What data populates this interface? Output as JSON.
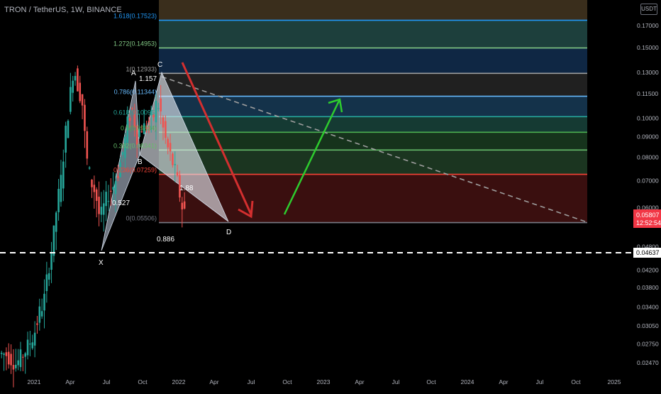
{
  "header": {
    "title": "TRON / TetherUS, 1W, BINANCE",
    "currency_badge": "USDT"
  },
  "chart_data": {
    "type": "candlestick",
    "symbol": "TRON / TetherUS",
    "interval": "1W",
    "exchange": "BINANCE",
    "y_axis": {
      "scale": "log",
      "ticks": [
        "0.17000",
        "0.15000",
        "0.13000",
        "0.11500",
        "0.10000",
        "0.09000",
        "0.08000",
        "0.07000",
        "0.06000",
        "0.04800",
        "0.04200",
        "0.03800",
        "0.03400",
        "0.03050",
        "0.02750",
        "0.02470"
      ],
      "ylim": [
        0.0235,
        0.19
      ]
    },
    "x_axis": {
      "ticks": [
        "2021",
        "Apr",
        "Jul",
        "Oct",
        "2022",
        "Apr",
        "Jul",
        "Oct",
        "2023",
        "Apr",
        "Jul",
        "Oct",
        "2024",
        "Apr",
        "Jul",
        "Oct",
        "2025"
      ]
    },
    "price_labels": {
      "last_price": "0.05807",
      "countdown": "12:52:54",
      "horizontal_line": "0.04637"
    },
    "fib_levels": [
      {
        "label": "1.618(0.17523)",
        "value": 0.17523,
        "color": "#2196f3"
      },
      {
        "label": "1.272(0.14953)",
        "value": 0.14953,
        "color": "#81c784"
      },
      {
        "label": "1(0.12933)",
        "value": 0.12933,
        "color": "#9e9e9e"
      },
      {
        "label": "0.786(0.11344)",
        "value": 0.11344,
        "color": "#64b5f6"
      },
      {
        "label": "0.618(0.10095)",
        "value": 0.10095,
        "color": "#26a69a"
      },
      {
        "label": "0.5(0.09234)",
        "value": 0.09234,
        "color": "#4caf50"
      },
      {
        "label": "0.382(0.08341)",
        "value": 0.08341,
        "color": "#66bb6a"
      },
      {
        "label": "0.236(0.07259)",
        "value": 0.07259,
        "color": "#f44336"
      },
      {
        "label": "0(0.05506)",
        "value": 0.05506,
        "color": "#787b86"
      }
    ],
    "harmonic_points": {
      "X": "X",
      "A": "A",
      "B": "B",
      "C": "C",
      "D": "D"
    },
    "harmonic_ratios": {
      "xab": "0.527",
      "abc": "1.157",
      "bcd": "1.88",
      "xad": "0.886"
    },
    "trend_arrows": [
      {
        "direction": "down",
        "color": "#d32f2f"
      },
      {
        "direction": "up",
        "color": "#2ecc2e"
      }
    ],
    "colors": {
      "up": "#26a69a",
      "down": "#ef5350",
      "background": "#000000",
      "axis_text": "#b2b5be"
    }
  }
}
